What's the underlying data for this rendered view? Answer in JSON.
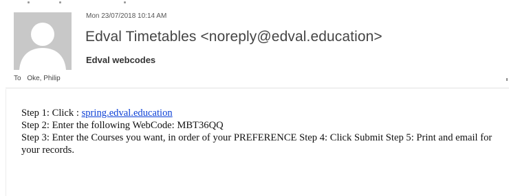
{
  "header": {
    "date": "Mon 23/07/2018 10:14 AM",
    "sender": "Edval Timetables <noreply@edval.education>",
    "subject": "Edval webcodes",
    "to_label": "To",
    "to_name": "Oke, Philip"
  },
  "body": {
    "step1_prefix": "Step 1: Click : ",
    "step1_link": "spring.edval.education",
    "step2": "Step 2: Enter the following WebCode: MBT36QQ",
    "step3": "Step 3: Enter the Courses you want, in order of your PREFERENCE Step 4: Click Submit Step 5: Print and email for your records."
  },
  "colors": {
    "link": "#0b3fd6",
    "avatar_bg": "#c8c8c8"
  },
  "icons": {
    "avatar": "person-silhouette-icon"
  }
}
